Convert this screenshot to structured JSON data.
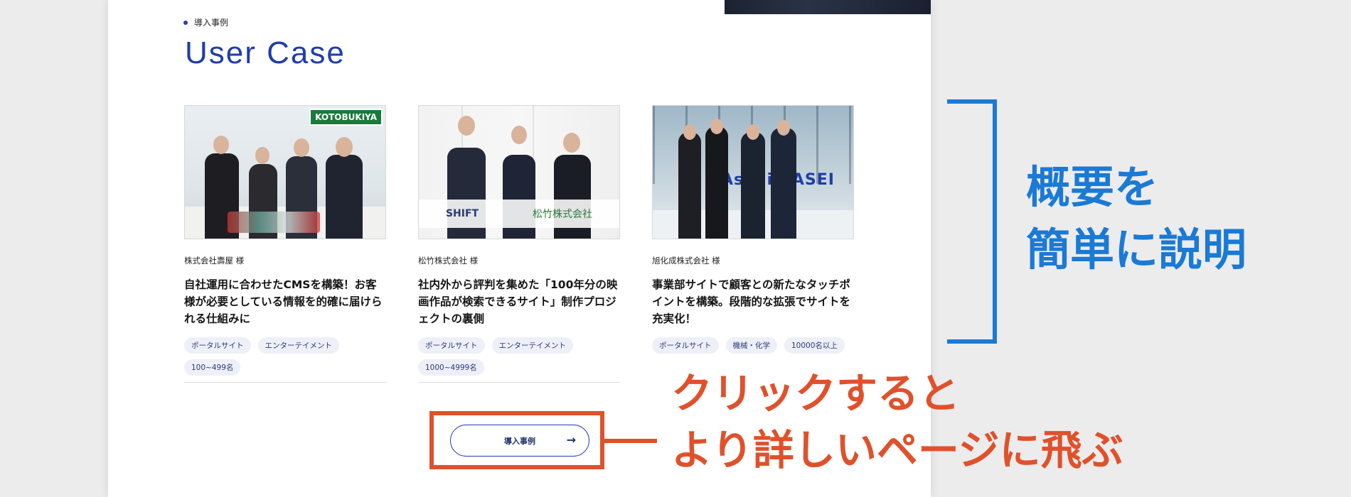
{
  "section": {
    "eyebrow": "導入事例",
    "heading": "User Case"
  },
  "cards": [
    {
      "client": "株式会社壽屋 様",
      "title": "自社運用に合わせたCMSを構築！お客様が必要としている情報を的確に届けられる仕組みに",
      "photo_logo": "KOTOBUKIYA",
      "tags": [
        "ポータルサイト",
        "エンターテイメント",
        "100~499名"
      ]
    },
    {
      "client": "松竹株式会社 様",
      "title": "社内外から評判を集めた「100年分の映画作品が検索できるサイト」制作プロジェクトの裏側",
      "photo_logo": "SHIFT",
      "photo_logo2": "松竹株式会社",
      "tags": [
        "ポータルサイト",
        "エンターテイメント",
        "1000~4999名"
      ]
    },
    {
      "client": "旭化成株式会社 様",
      "title": "事業部サイトで顧客との新たなタッチポイントを構築。段階的な拡張でサイトを充実化！",
      "photo_logo": "Asahi KASEI",
      "tags": [
        "ポータルサイト",
        "機械・化学",
        "10000名以上"
      ]
    }
  ],
  "button": {
    "label": "導入事例",
    "icon": "arrow-right-icon"
  },
  "annotations": {
    "red_line1": "クリックすると",
    "red_line2": "より詳しいページに飛ぶ",
    "blue_line1": "概要を",
    "blue_line2": "簡単に説明",
    "red_color": "#e0512b",
    "blue_color": "#1a7ad6"
  },
  "colors": {
    "brand": "#1f3ea8"
  }
}
